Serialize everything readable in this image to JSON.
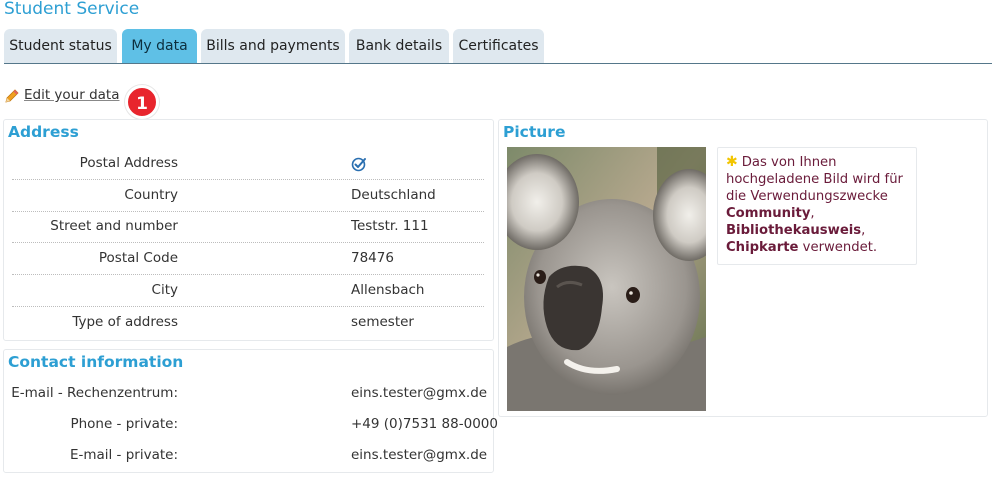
{
  "page_title": "Student Service",
  "tabs": [
    {
      "label": "Student status",
      "active": false
    },
    {
      "label": "My data",
      "active": true
    },
    {
      "label": "Bills and payments",
      "active": false
    },
    {
      "label": "Bank details",
      "active": false
    },
    {
      "label": "Certificates",
      "active": false
    }
  ],
  "edit": {
    "link_label": "Edit your data",
    "badge": "1",
    "icon": "pencil-icon"
  },
  "address": {
    "title": "Address",
    "rows": [
      {
        "label": "Postal Address",
        "value": "",
        "icon": "check-circle-icon"
      },
      {
        "label": "Country",
        "value": "Deutschland"
      },
      {
        "label": "Street and number",
        "value": "Teststr. 111"
      },
      {
        "label": "Postal Code",
        "value": "78476"
      },
      {
        "label": "City",
        "value": "Allensbach"
      },
      {
        "label": "Type of address",
        "value": "semester"
      }
    ]
  },
  "contact": {
    "title": "Contact information",
    "rows": [
      {
        "label": "E-mail - Rechenzentrum:",
        "value": "eins.tester@gmx.de"
      },
      {
        "label": "Phone - private:",
        "value": "+49 (0)7531 88-0000"
      },
      {
        "label": "E-mail - private:",
        "value": "eins.tester@gmx.de"
      }
    ]
  },
  "picture": {
    "title": "Picture",
    "notice": {
      "text_before": "Das von Ihnen hochgeladene Bild wird für die Verwendungszwecke",
      "purpose_1": "Community",
      "purpose_2": "Bibliothekausweis",
      "purpose_3": "Chipkarte",
      "text_after": "verwendet.",
      "icon": "asterisk-icon"
    }
  },
  "colors": {
    "accent": "#2d9fd3",
    "active_tab": "#5fc0e6",
    "tab": "#dfe8ef",
    "badge": "#e8252d",
    "notice_text": "#6a1b3a"
  }
}
